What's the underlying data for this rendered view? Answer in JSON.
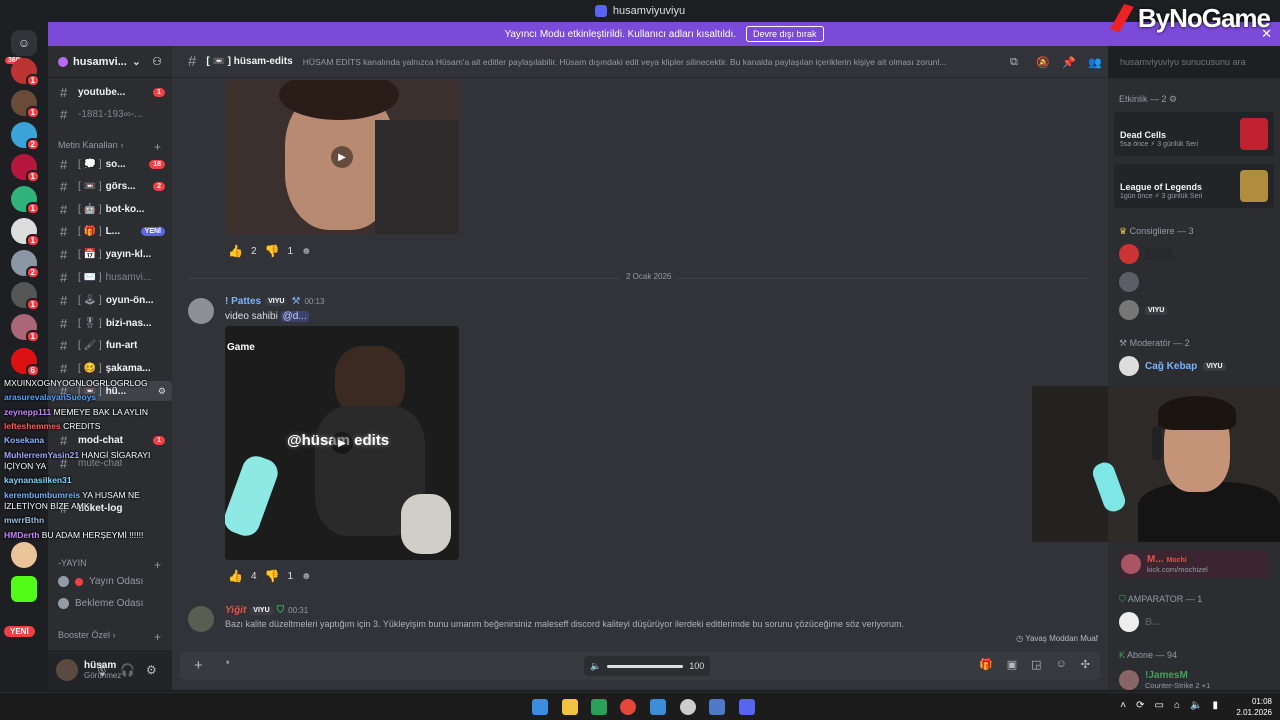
{
  "window": {
    "title": "husamviyuviyu"
  },
  "watermark": "ByNoGame",
  "banner": {
    "text": "Yayıncı Modu etkinleştirildi. Kullanıcı adları kısaltıldı.",
    "button": "Devre dışı bırak",
    "close": "✕"
  },
  "rail": {
    "dm_badge": "360",
    "badges": [
      "1",
      "1",
      "2",
      "1",
      "1",
      "1",
      "2",
      "1",
      "1",
      "6"
    ],
    "badge_164": "164",
    "new": "YENİ"
  },
  "server": {
    "name": "husamvi...",
    "chevron": "⌄"
  },
  "channels_top": [
    {
      "label": "youtube...",
      "count": "1"
    },
    {
      "label": "-1881-193∞-..."
    }
  ],
  "categories": {
    "text": "Metin Kanalları",
    "yayin": "-YAYIN",
    "booster": "Booster Özel"
  },
  "channels": [
    {
      "br": "[ 💭 ]",
      "label": "so...",
      "count": "18"
    },
    {
      "br": "[ 📼 ]",
      "label": "görs...",
      "count": "2"
    },
    {
      "br": "[ 🤖 ]",
      "label": "bot-ko..."
    },
    {
      "br": "[ 🎁 ]",
      "label": "L...",
      "new": "YENİ"
    },
    {
      "br": "[ 📅 ]",
      "label": "yayın-kl..."
    },
    {
      "br": "[ ✉️ ]",
      "label": "husamvi...",
      "muted": true
    },
    {
      "br": "[ 🕹 ]",
      "label": "oyun-ön..."
    },
    {
      "br": "[ 🎖 ]",
      "label": "bizi-nas..."
    },
    {
      "br": "[ 🖌 ]",
      "label": "fun-art"
    },
    {
      "br": "[ 🥴 ]",
      "label": "şakama..."
    },
    {
      "br": "[ 📼 ]",
      "label": "hü..."
    },
    {
      "label": "mod-chat",
      "count": "1"
    },
    {
      "label": "mute-chat"
    },
    {
      "label": "ticket-log"
    }
  ],
  "voice": [
    "Yayın Odası",
    "Bekleme Odası"
  ],
  "user": {
    "name": "hüsam",
    "status": "Görünmez"
  },
  "chat": {
    "header_title": "[ 📼 ] hüsam-edits",
    "topic": "HÜSAM EDİTS kanalında yalnızca Hüsam'a ait editler paylaşılabilir. Hüsam dışındaki edit veya klipler silinecektir. Bu kanalda paylaşılan içeriklerin kişiye ait olması zorunl...",
    "search_placeholder": "husamviyuviyu sunucusunu ara",
    "date_divider": "2 Ocak 2026",
    "reactions1": {
      "up": "2",
      "down": "1"
    },
    "reactions2": {
      "up": "4",
      "down": "1"
    },
    "msg1": {
      "user": "! Pattes",
      "tag": "VIYU",
      "time": "00:13",
      "text": "video sahibi",
      "mention": "@d..."
    },
    "msg2": {
      "user": "Yiğit",
      "tag": "VIYU",
      "time": "00:31",
      "text": "Bazı kalite düzeltmeleri yaptığım için 3. Yükleyişim bunu umarım beğenirsiniz maleseff discord kaliteyi düşürüyor ilerdeki editlerimde bu sorunu çözüceğime söz veriyorum."
    },
    "video2_label": "Game",
    "video2_overlay": "@hüsam edits",
    "slowmode": "Yavaş Moddan Muaf",
    "composer_caret": "*",
    "volume_value": 100,
    "volume_label": "100"
  },
  "members": {
    "activity_header": "Etkinlik — 2",
    "activities": [
      {
        "game": "Dead Cells",
        "sub": "5sa önce  ⚡ 3 günlük Seri",
        "color": "#c0212f"
      },
      {
        "game": "League of Legends",
        "sub": "1gün önce  ⚡ 3 günlük Seri",
        "color": "#b08d3c"
      }
    ],
    "consigliere_header": "Consigliere — 3",
    "moderator_header": "Moderatör — 2",
    "mod1": "Cağ Kebap",
    "mod1_tag": "VIYU",
    "tag_viyu": "VIYU",
    "mochi_name": "M...",
    "mochi_tag": "Mochi",
    "mochi_sub": "kick.com/mochizel",
    "amparator_header": "AMPARATOR — 1",
    "amparator_name": "B...",
    "abone_header": "Abone — 94",
    "abone1": "!JamesM",
    "abone1_sub": "Counter-Strike 2 +1"
  },
  "overlay_chat": [
    {
      "user": "",
      "msg": "MXUINXOGNYOGNLOGRLOGRLOG",
      "color": "#ffffff"
    },
    {
      "user": "arasurevalayanSueoys",
      "msg": "",
      "color": "#4fa3ff"
    },
    {
      "user": "zeynepp111",
      "msg": "MEMEYE BAK LA AYLIN",
      "color": "#c084fc"
    },
    {
      "user": "lefteshemmes",
      "msg": "CREDITS",
      "color": "#ff5a5a"
    },
    {
      "user": "Kosekana",
      "msg": "",
      "color": "#8ab4ff"
    },
    {
      "user": "MuhlerremYasin21",
      "msg": "HANGİ SİGARAYI İÇİYON YA",
      "color": "#a4a4ff"
    },
    {
      "user": "kaynanasilken31",
      "msg": "",
      "color": "#7fd7ff"
    },
    {
      "user": "kerembumbumreis",
      "msg": "YA HUSAM NE İZLETİYON BİZE AMK",
      "color": "#6fb3ff"
    },
    {
      "user": "mwrrBthn",
      "msg": "",
      "color": "#9bd"
    },
    {
      "user": "HMDerth",
      "msg": "BU ADAM HERŞEYMİ !!!!!!",
      "color": "#c084fc"
    }
  ],
  "taskbar": {
    "time": "01:08",
    "date": "2.01.2026"
  }
}
